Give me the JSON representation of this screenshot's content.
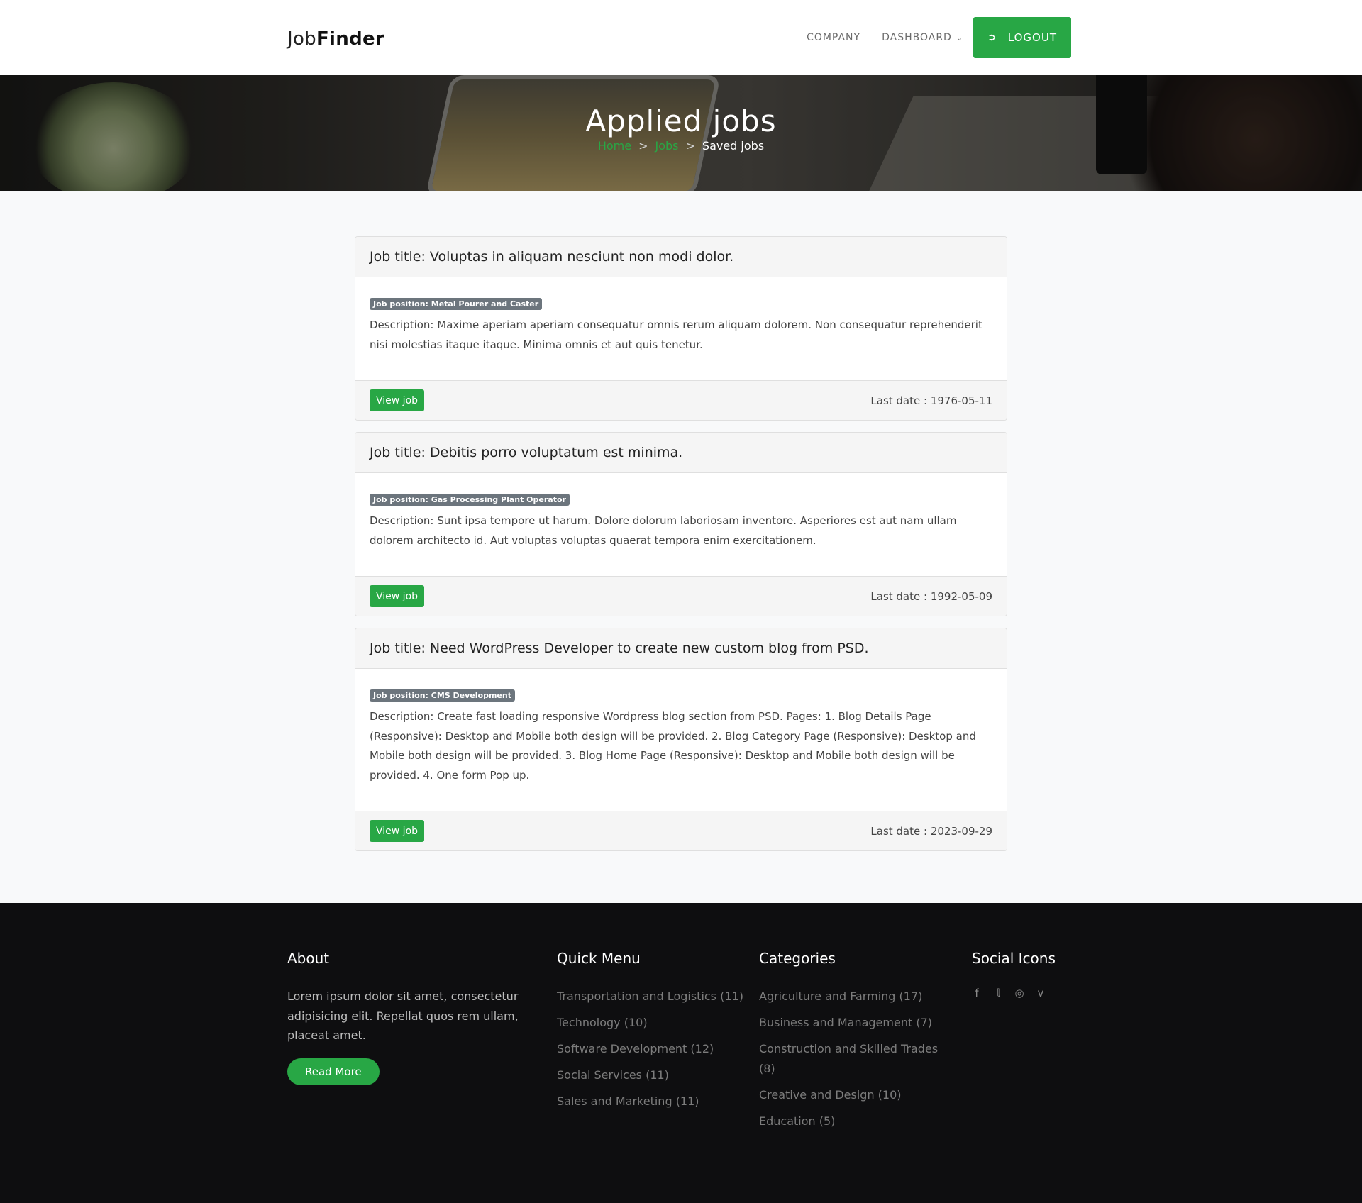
{
  "brand": {
    "light": "Job",
    "bold": "Finder"
  },
  "nav": {
    "company": "COMPANY",
    "dashboard": "DASHBOARD",
    "logout": "LOGOUT"
  },
  "hero": {
    "title": "Applied jobs",
    "breadcrumbs": {
      "home": "Home",
      "jobs": "Jobs",
      "current": "Saved jobs",
      "separator": ">"
    }
  },
  "jobs": [
    {
      "title": "Job title: Voluptas in aliquam nesciunt non modi dolor.",
      "position": "Job position: Metal Pourer and Caster",
      "description": "Description: Maxime aperiam aperiam consequatur omnis rerum aliquam dolorem. Non consequatur reprehenderit nisi molestias itaque itaque. Minima omnis et aut quis tenetur.",
      "button": "View job",
      "last_date": "Last date : 1976-05-11"
    },
    {
      "title": "Job title: Debitis porro voluptatum est minima.",
      "position": "Job position: Gas Processing Plant Operator",
      "description": "Description: Sunt ipsa tempore ut harum. Dolore dolorum laboriosam inventore. Asperiores est aut nam ullam dolorem architecto id. Aut voluptas voluptas quaerat tempora enim exercitationem.",
      "button": "View job",
      "last_date": "Last date : 1992-05-09"
    },
    {
      "title": "Job title: Need WordPress Developer to create new custom blog from PSD.",
      "position": "Job position: CMS Development",
      "description": "Description: Create fast loading responsive Wordpress blog section from PSD. Pages: 1. Blog Details Page (Responsive): Desktop and Mobile both design will be provided. 2. Blog Category Page (Responsive): Desktop and Mobile both design will be provided. 3. Blog Home Page (Responsive): Desktop and Mobile both design will be provided. 4. One form Pop up.",
      "button": "View job",
      "last_date": "Last date : 2023-09-29"
    }
  ],
  "footer": {
    "about": {
      "heading": "About",
      "text": "Lorem ipsum dolor sit amet, consectetur adipisicing elit. Repellat quos rem ullam, placeat amet.",
      "button": "Read More"
    },
    "quick_menu": {
      "heading": "Quick Menu",
      "items": [
        "Transportation and Logistics (11)",
        "Technology (10)",
        "Software Development (12)",
        "Social Services (11)",
        "Sales and Marketing (11)"
      ]
    },
    "categories": {
      "heading": "Categories",
      "items": [
        "Agriculture and Farming (17)",
        "Business and Management (7)",
        "Construction and Skilled Trades (8)",
        "Creative and Design (10)",
        "Education (5)"
      ]
    },
    "social": {
      "heading": "Social Icons",
      "icons": [
        "facebook-icon",
        "twitter-icon",
        "instagram-icon",
        "vimeo-icon"
      ]
    }
  },
  "colors": {
    "accent": "#28a745",
    "footer_bg": "#0e0e10",
    "badge": "#6c757d"
  }
}
